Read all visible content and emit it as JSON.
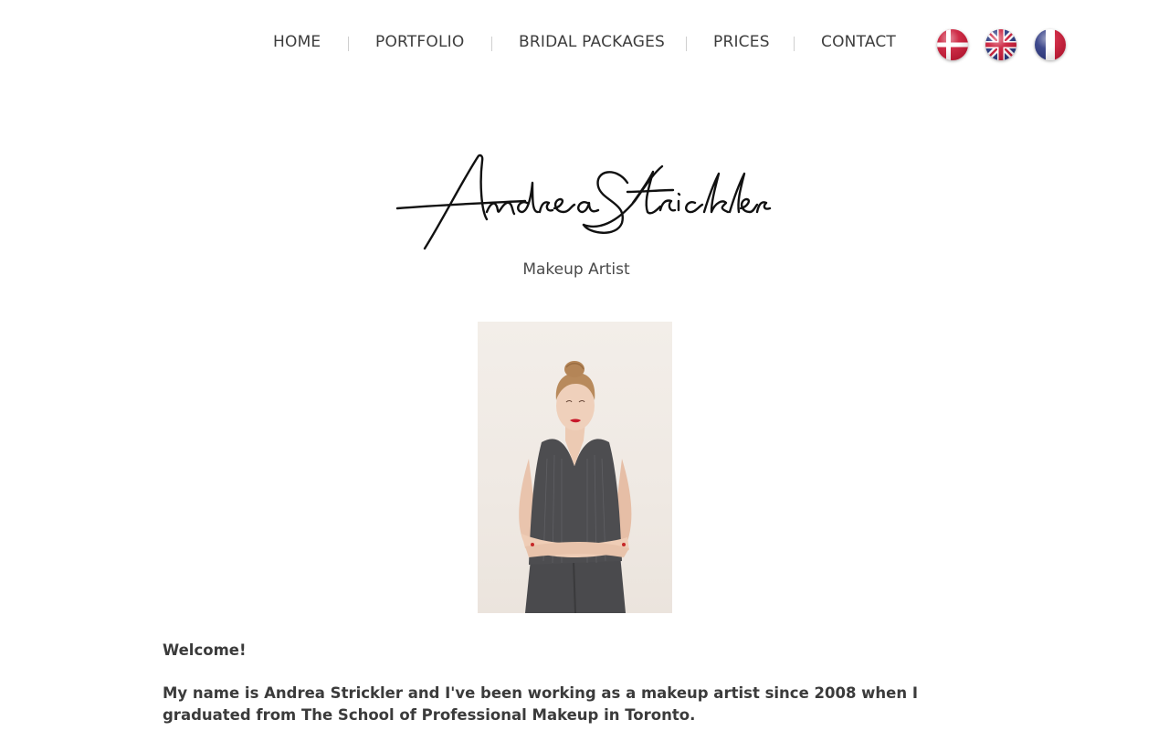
{
  "nav": {
    "items": [
      {
        "label": "HOME"
      },
      {
        "label": "PORTFOLIO"
      },
      {
        "label": "BRIDAL PACKAGES"
      },
      {
        "label": "PRICES"
      },
      {
        "label": "CONTACT"
      }
    ]
  },
  "languages": [
    {
      "icon": "danish-flag-icon"
    },
    {
      "icon": "uk-flag-icon"
    },
    {
      "icon": "french-flag-icon"
    }
  ],
  "hero": {
    "name": "Andrea Strickler",
    "subtitle": "Makeup Artist",
    "photo_icon": "portrait-photo"
  },
  "content": {
    "welcome": "Welcome!",
    "intro": "My name is Andrea Strickler and I've been working as a makeup artist since 2008 when I graduated from The School of Professional Makeup in Toronto."
  },
  "colors": {
    "text": "#3b3b3b",
    "separator": "#cfcfcf",
    "background": "#ffffff"
  }
}
